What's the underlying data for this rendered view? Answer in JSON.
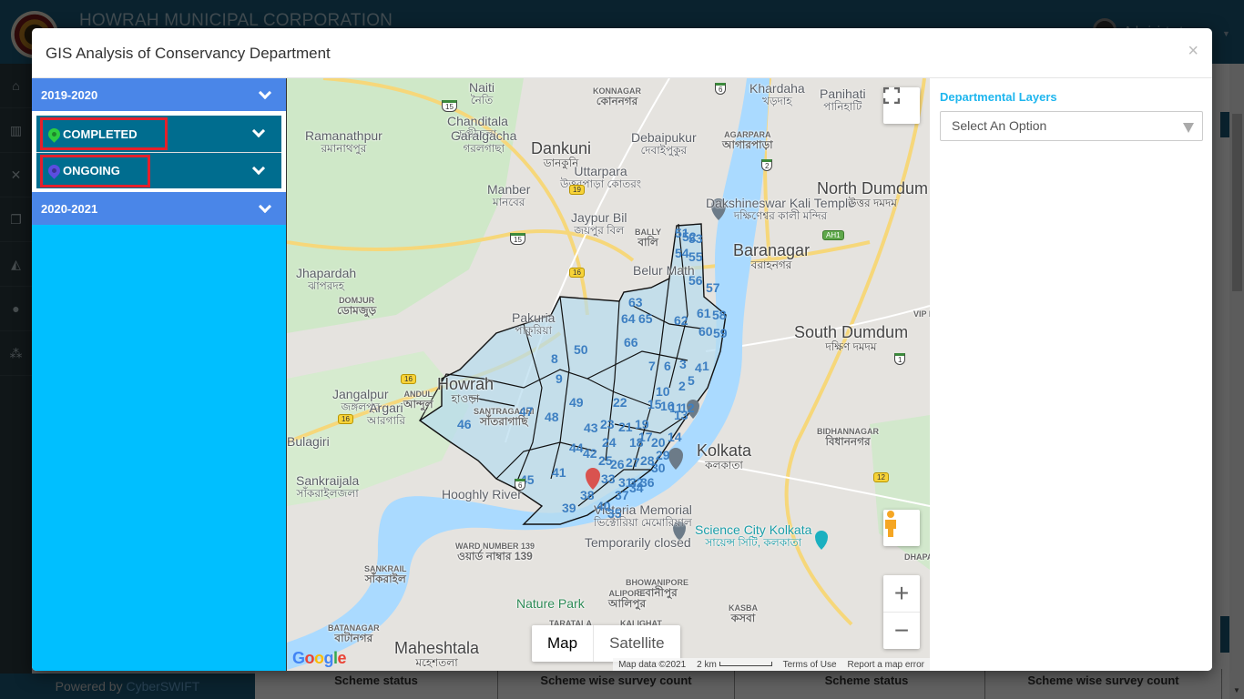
{
  "app": {
    "title": "HOWRAH MUNICIPAL CORPORATION",
    "user_name": "Administrator",
    "powered_by_prefix": "Powered by ",
    "powered_by_brand": "CyberSWIFT",
    "sidebar_icons": [
      "home-icon",
      "map-icon",
      "expand-icon",
      "copy-icon",
      "area-chart-icon",
      "user-icon",
      "users-icon"
    ],
    "panels": [
      "Scheme status",
      "Scheme wise survey count",
      "Scheme status",
      "Scheme wise survey count"
    ]
  },
  "modal": {
    "title": "GIS Analysis of Conservancy Department",
    "close_label": "×",
    "accordion": [
      {
        "label": "2019-2020",
        "expanded": true,
        "children": [
          {
            "label": "COMPLETED",
            "pin_color": "#2ecc40"
          },
          {
            "label": "ONGOING",
            "pin_color": "#5b4de0"
          }
        ]
      },
      {
        "label": "2020-2021",
        "expanded": false,
        "children": []
      }
    ],
    "map": {
      "labels": [
        {
          "en": "Naiti",
          "bn": "নৈতি"
        },
        {
          "en": "KONNAGAR",
          "bn": "কোননগর"
        },
        {
          "en": "Khardaha",
          "bn": "খড়দাহ"
        },
        {
          "en": "Panihati",
          "bn": "পানিহাটি"
        },
        {
          "en": "Chanditala",
          "bn": "চণ্ডীতলা"
        },
        {
          "en": "Ramanathpur",
          "bn": "রমানাথপুর"
        },
        {
          "en": "Garalgacha",
          "bn": "গরলগাছা"
        },
        {
          "en": "Dankuni",
          "bn": "ডানকুনি"
        },
        {
          "en": "Debaipukur",
          "bn": "দেবাইপুকুর"
        },
        {
          "en": "AGARPARA",
          "bn": "আগারপাড়া"
        },
        {
          "en": "Uttarpara",
          "bn": "উত্তরপাড়া কোতরং"
        },
        {
          "en": "Manber",
          "bn": "মানবের"
        },
        {
          "en": "Dakshineswar Kali Temple",
          "bn": "দক্ষিণেশ্বর কালী মন্দির"
        },
        {
          "en": "North Dumdum",
          "bn": "উত্তর দমদম"
        },
        {
          "en": "Jaypur Bil",
          "bn": "জয়পুর বিল"
        },
        {
          "en": "BALLY",
          "bn": "বালি"
        },
        {
          "en": "Baranagar",
          "bn": "বরাহনগর"
        },
        {
          "en": "Jhapardah",
          "bn": "ঝাপরদহ"
        },
        {
          "en": "Belur Math",
          "bn": ""
        },
        {
          "en": "DOMJUR",
          "bn": "ডোমজুড়"
        },
        {
          "en": "Pakuria",
          "bn": "পাকুরিয়া"
        },
        {
          "en": "South Dumdum",
          "bn": "দক্ষিণ দমদম"
        },
        {
          "en": "Howrah",
          "bn": "হাওড়া"
        },
        {
          "en": "Jangalpur",
          "bn": "জঙ্গলপুর"
        },
        {
          "en": "ANDUL",
          "bn": "আন্দুল"
        },
        {
          "en": "SANTRAGACHI",
          "bn": "সাঁতরাগাছি"
        },
        {
          "en": "Argari",
          "bn": "আরগারি"
        },
        {
          "en": "Kolkata",
          "bn": "কলকাতা"
        },
        {
          "en": "BIDHANNAGAR",
          "bn": "বিধাননগর"
        },
        {
          "en": "Sankraijala",
          "bn": "সাঁকরাইলজলা"
        },
        {
          "en": "Victoria Memorial",
          "bn": "ভিক্টোরিয়া মেমোরিয়াল"
        },
        {
          "en": "Temporarily closed",
          "bn": ""
        },
        {
          "en": "Science City Kolkata",
          "bn": "সায়েন্স সিটি, কলকাতা"
        },
        {
          "en": "WARD NUMBER 139",
          "bn": "ওয়ার্ড নাম্বার 139"
        },
        {
          "en": "SANKRAIL",
          "bn": "সাঁকরাইল"
        },
        {
          "en": "BHOWANIPORE",
          "bn": "ভবানীপুর"
        },
        {
          "en": "ALIPORE",
          "bn": "আলিপুর"
        },
        {
          "en": "Nature Park",
          "bn": ""
        },
        {
          "en": "TARATALA",
          "bn": ""
        },
        {
          "en": "KALIGHAT",
          "bn": "কালীঘাট"
        },
        {
          "en": "KASBA",
          "bn": "কসবা"
        },
        {
          "en": "BATANAGAR",
          "bn": "বাটানগর"
        },
        {
          "en": "Maheshtala",
          "bn": "মহেশতলা"
        },
        {
          "en": "Hooghly River",
          "bn": ""
        },
        {
          "en": "VIP Rd",
          "bn": ""
        },
        {
          "en": "Bulagiri",
          "bn": ""
        },
        {
          "en": "DHAPA",
          "bn": ""
        }
      ],
      "wards": [
        "53",
        "54",
        "55",
        "56",
        "57",
        "51",
        "52",
        "63",
        "64",
        "65",
        "62",
        "61",
        "58",
        "60",
        "59",
        "66",
        "50",
        "7",
        "6",
        "3",
        "4",
        "2",
        "1",
        "5",
        "8",
        "9",
        "10",
        "11",
        "12",
        "15",
        "16",
        "22",
        "49",
        "47",
        "48",
        "43",
        "23",
        "21",
        "19",
        "46",
        "44",
        "24",
        "18",
        "17",
        "20",
        "13",
        "14",
        "42",
        "25",
        "26",
        "27",
        "28",
        "29",
        "30",
        "41",
        "45",
        "33",
        "31",
        "32",
        "34",
        "36",
        "37",
        "38",
        "39",
        "40",
        "35"
      ],
      "highway_shields": [
        "6",
        "15",
        "15",
        "16",
        "19",
        "2",
        "AH1",
        "16",
        "16",
        "1",
        "12",
        "6"
      ],
      "map_type_options": [
        "Map",
        "Satellite"
      ],
      "map_type_selected": "Map",
      "footer": [
        "Map data ©2021",
        "2 km",
        "Terms of Use",
        "Report a map error"
      ],
      "google_logo": "Google",
      "controls": [
        "fullscreen",
        "street-view",
        "zoom-in",
        "zoom-out"
      ]
    },
    "right_panel": {
      "title": "Departmental Layers",
      "select_placeholder": "Select An Option"
    }
  }
}
